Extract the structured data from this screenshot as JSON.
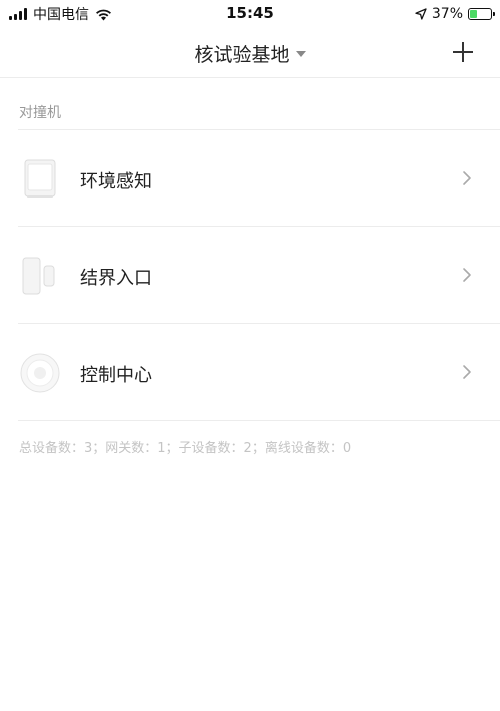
{
  "status_bar": {
    "carrier": "中国电信",
    "time": "15:45",
    "battery_percent": "37%",
    "battery_level": 0.37,
    "icons": [
      "signal-icon",
      "wifi-icon",
      "location-icon",
      "battery-icon"
    ]
  },
  "nav": {
    "title": "核试验基地",
    "add_icon": "plus-icon"
  },
  "section": {
    "title": "对撞机"
  },
  "devices": [
    {
      "label": "环境感知",
      "icon": "motion-sensor-icon"
    },
    {
      "label": "结界入口",
      "icon": "door-sensor-icon"
    },
    {
      "label": "控制中心",
      "icon": "gateway-icon"
    }
  ],
  "summary": "总设备数：3；网关数：1；子设备数：2；离线设备数：0",
  "colors": {
    "battery_charge": "#4cd964",
    "divider": "#ececec",
    "muted_text": "#999999"
  }
}
